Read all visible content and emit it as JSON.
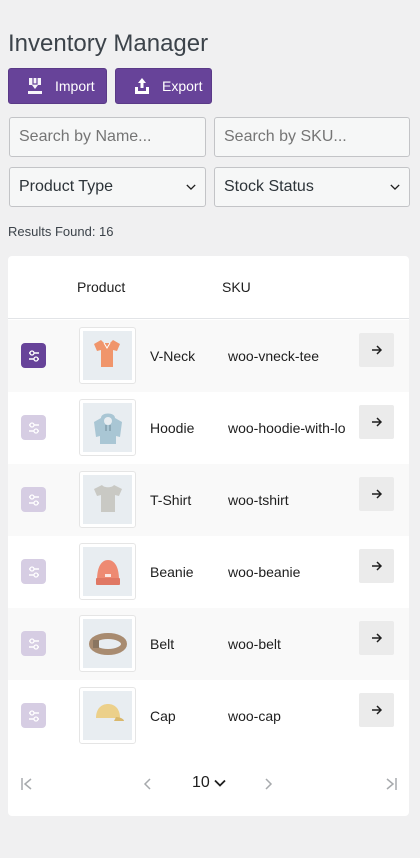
{
  "header": {
    "title": "Inventory Manager"
  },
  "toolbar": {
    "import_label": "Import",
    "export_label": "Export"
  },
  "filters": {
    "name_placeholder": "Search by Name...",
    "sku_placeholder": "Search by SKU...",
    "product_type": "Product Type",
    "stock_status": "Stock Status"
  },
  "results": {
    "text": "Results Found: 16"
  },
  "table": {
    "columns": {
      "product": "Product",
      "sku": "SKU"
    },
    "rows": [
      {
        "name": "V-Neck",
        "sku": "woo-vneck-tee",
        "icon": "vneck-tee-icon",
        "color": "#f0956b",
        "selected": true
      },
      {
        "name": "Hoodie",
        "sku": "woo-hoodie-with-logo",
        "icon": "hoodie-icon",
        "color": "#a9c6d4",
        "selected": false
      },
      {
        "name": "T-Shirt",
        "sku": "woo-tshirt",
        "icon": "tshirt-icon",
        "color": "#c9c9c4",
        "selected": false
      },
      {
        "name": "Beanie",
        "sku": "woo-beanie",
        "icon": "beanie-icon",
        "color": "#ee8a72",
        "selected": false
      },
      {
        "name": "Belt",
        "sku": "woo-belt",
        "icon": "belt-icon",
        "color": "#a88b70",
        "selected": false
      },
      {
        "name": "Cap",
        "sku": "woo-cap",
        "icon": "cap-icon",
        "color": "#ecd08a",
        "selected": false
      }
    ]
  },
  "pagination": {
    "page_size": "10"
  },
  "colors": {
    "accent": "#674399",
    "accent_light": "#d6cde3"
  }
}
